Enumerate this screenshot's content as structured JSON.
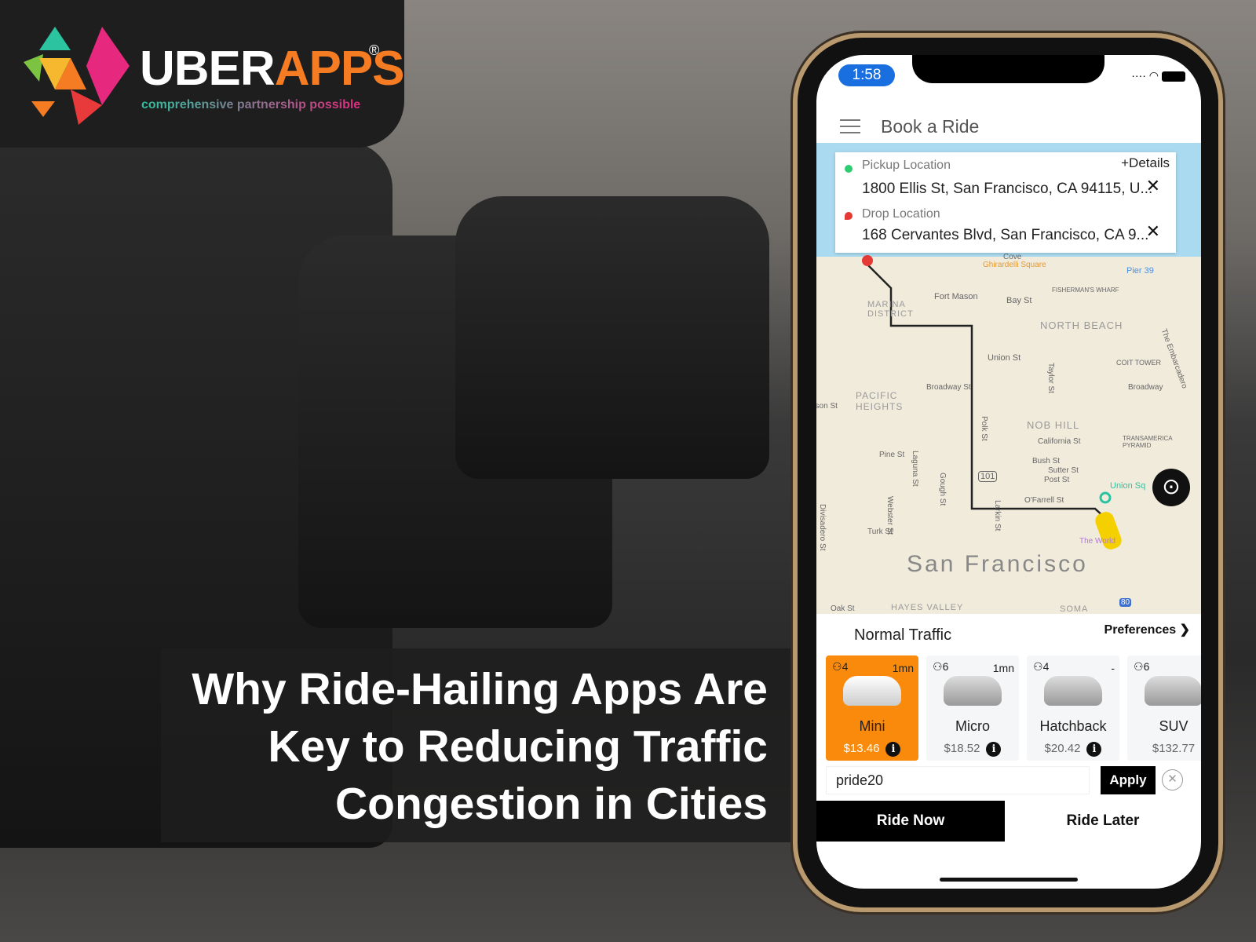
{
  "brand": {
    "name_part1": "UBER",
    "name_part2": "APPS",
    "registered": "®",
    "tagline": "comprehensive partnership possible",
    "accent": "#f57c22"
  },
  "headline": {
    "lines": [
      "Why Ride-Hailing Apps Are",
      "Key to Reducing Traffic",
      "Congestion in Cities"
    ]
  },
  "phone": {
    "status": {
      "time": "1:58"
    },
    "header": {
      "title": "Book a Ride",
      "menu_icon": "hamburger-icon"
    },
    "locations": {
      "details_label": "+Details",
      "pickup_label": "Pickup Location",
      "pickup_value": "1800 Ellis St, San Francisco, CA 94115, U...",
      "drop_label": "Drop Location",
      "drop_value": "168 Cervantes Blvd, San Francisco, CA 9..."
    },
    "map": {
      "city": "San Francisco",
      "labels": [
        "Fort Mason",
        "MARINA DISTRICT",
        "Ghirardelli Square",
        "Bay St",
        "FISHERMAN'S WHARF",
        "Pier 39",
        "NORTH BEACH",
        "COIT TOWER",
        "Union St",
        "Broadway St",
        "Broadway",
        "PACIFIC HEIGHTS",
        "NOB HILL",
        "California St",
        "TRANSAMERICA PYRAMID",
        "Pine St",
        "Bush St",
        "Sutter St",
        "Post St",
        "Union Sq",
        "O'Farrell St",
        "Turk St",
        "101",
        "Polk St",
        "Laguna St",
        "Gough St",
        "Webster St",
        "Larkin St",
        "Taylor St",
        "Divisadero St",
        "The World",
        "Oak St",
        "HAYES VALLEY",
        "SOMA",
        "80",
        "Cove",
        "The Embarcadero",
        "Jackson St"
      ]
    },
    "traffic_label": "Normal Traffic",
    "preferences_label": "Preferences",
    "vehicles": [
      {
        "capacity": "4",
        "eta": "1mn",
        "name": "Mini",
        "price": "$13.46",
        "selected": true
      },
      {
        "capacity": "6",
        "eta": "1mn",
        "name": "Micro",
        "price": "$18.52",
        "selected": false
      },
      {
        "capacity": "4",
        "eta": "-",
        "name": "Hatchback",
        "price": "$20.42",
        "selected": false
      },
      {
        "capacity": "6",
        "eta": "",
        "name": "SUV",
        "price": "$132.77",
        "selected": false
      }
    ],
    "promo": {
      "value": "pride20",
      "apply_label": "Apply"
    },
    "actions": {
      "ride_now": "Ride Now",
      "ride_later": "Ride Later"
    },
    "selected_color": "#f98a0c"
  }
}
